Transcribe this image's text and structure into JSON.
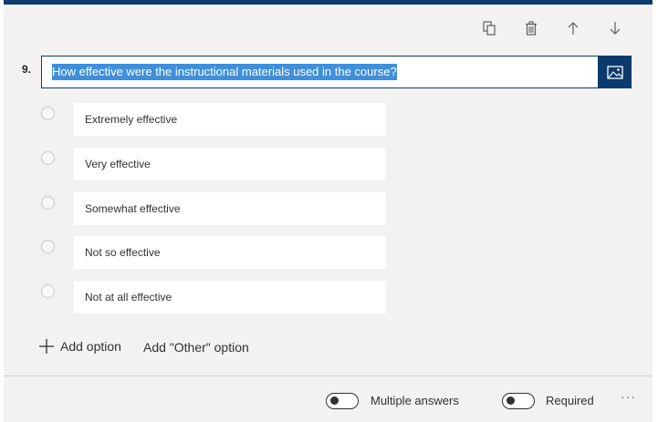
{
  "toolbar": {
    "icons": [
      "copy-icon",
      "delete-icon",
      "move-up-icon",
      "move-down-icon"
    ]
  },
  "question": {
    "number": "9.",
    "text": "How effective were the instructional materials used in the course?",
    "image_icon": "image-icon"
  },
  "options": [
    {
      "label": "Extremely effective"
    },
    {
      "label": "Very effective"
    },
    {
      "label": "Somewhat effective"
    },
    {
      "label": "Not so effective"
    },
    {
      "label": "Not at all effective"
    }
  ],
  "actions": {
    "add_option": "Add option",
    "add_other_option": "Add \"Other\" option"
  },
  "footer": {
    "multiple_answers_label": "Multiple answers",
    "multiple_answers_on": false,
    "required_label": "Required",
    "required_on": false,
    "more_label": "···"
  },
  "colors": {
    "accent": "#0b3a6e",
    "selection": "#3f8fdc",
    "background": "#f3f2f1"
  }
}
